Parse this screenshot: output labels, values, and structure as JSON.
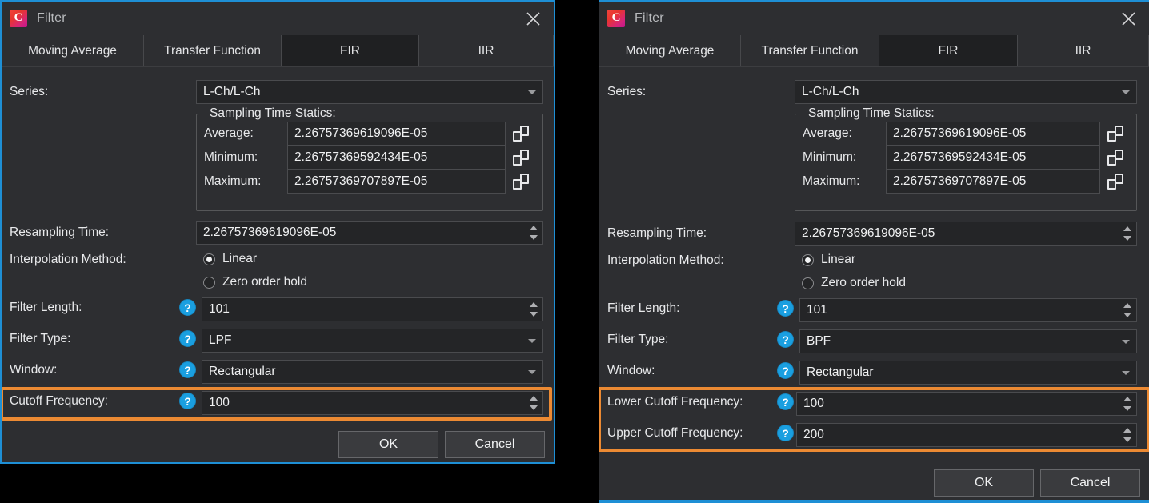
{
  "colors": {
    "accent_border": "#1e8fd5",
    "highlight": "#ec8a33",
    "help_icon": "#1a9fe0",
    "panel_bg": "#2d2e31",
    "field_bg": "#242527"
  },
  "panels": [
    {
      "id": "left",
      "titlebar": {
        "app_icon": "camera-c-icon",
        "title": "Filter",
        "close_icon": "close-icon"
      },
      "tabs": [
        {
          "label": "Moving Average",
          "selected": false
        },
        {
          "label": "Transfer Function",
          "selected": false
        },
        {
          "label": "FIR",
          "selected": true
        },
        {
          "label": "IIR",
          "selected": false
        }
      ],
      "series": {
        "label": "Series:",
        "value": "L-Ch/L-Ch",
        "caret_icon": "chevron-down-icon"
      },
      "sampling_group": {
        "legend": "Sampling Time Statics:",
        "rows": [
          {
            "label": "Average:",
            "value": "2.26757369619096E-05",
            "copy_icon": "copy-icon"
          },
          {
            "label": "Minimum:",
            "value": "2.26757369592434E-05",
            "copy_icon": "copy-icon"
          },
          {
            "label": "Maximum:",
            "value": "2.26757369707897E-05",
            "copy_icon": "copy-icon"
          }
        ]
      },
      "resampling": {
        "label": "Resampling Time:",
        "value": "2.26757369619096E-05"
      },
      "interpolation": {
        "label": "Interpolation Method:",
        "options": [
          {
            "label": "Linear",
            "selected": true
          },
          {
            "label": "Zero order hold",
            "selected": false
          }
        ]
      },
      "filter_length": {
        "label": "Filter Length:",
        "value": "101",
        "help_icon": "help-icon"
      },
      "filter_type": {
        "label": "Filter Type:",
        "value": "LPF",
        "help_icon": "help-icon"
      },
      "window": {
        "label": "Window:",
        "value": "Rectangular",
        "help_icon": "help-icon"
      },
      "cutoff_rows": [
        {
          "label": "Cutoff Frequency:",
          "value": "100",
          "help_icon": "help-icon",
          "highlighted": true
        }
      ],
      "buttons": {
        "ok": "OK",
        "cancel": "Cancel"
      }
    },
    {
      "id": "right",
      "titlebar": {
        "app_icon": "camera-c-icon",
        "title": "Filter",
        "close_icon": "close-icon"
      },
      "tabs": [
        {
          "label": "Moving Average",
          "selected": false
        },
        {
          "label": "Transfer Function",
          "selected": false
        },
        {
          "label": "FIR",
          "selected": true
        },
        {
          "label": "IIR",
          "selected": false
        }
      ],
      "series": {
        "label": "Series:",
        "value": "L-Ch/L-Ch",
        "caret_icon": "chevron-down-icon"
      },
      "sampling_group": {
        "legend": "Sampling Time Statics:",
        "rows": [
          {
            "label": "Average:",
            "value": "2.26757369619096E-05",
            "copy_icon": "copy-icon"
          },
          {
            "label": "Minimum:",
            "value": "2.26757369592434E-05",
            "copy_icon": "copy-icon"
          },
          {
            "label": "Maximum:",
            "value": "2.26757369707897E-05",
            "copy_icon": "copy-icon"
          }
        ]
      },
      "resampling": {
        "label": "Resampling Time:",
        "value": "2.26757369619096E-05"
      },
      "interpolation": {
        "label": "Interpolation Method:",
        "options": [
          {
            "label": "Linear",
            "selected": true
          },
          {
            "label": "Zero order hold",
            "selected": false
          }
        ]
      },
      "filter_length": {
        "label": "Filter Length:",
        "value": "101",
        "help_icon": "help-icon"
      },
      "filter_type": {
        "label": "Filter Type:",
        "value": "BPF",
        "help_icon": "help-icon"
      },
      "window": {
        "label": "Window:",
        "value": "Rectangular",
        "help_icon": "help-icon"
      },
      "cutoff_rows": [
        {
          "label": "Lower Cutoff Frequency:",
          "value": "100",
          "help_icon": "help-icon",
          "highlighted": true
        },
        {
          "label": "Upper Cutoff Frequency:",
          "value": "200",
          "help_icon": "help-icon",
          "highlighted": true
        }
      ],
      "buttons": {
        "ok": "OK",
        "cancel": "Cancel"
      }
    }
  ]
}
